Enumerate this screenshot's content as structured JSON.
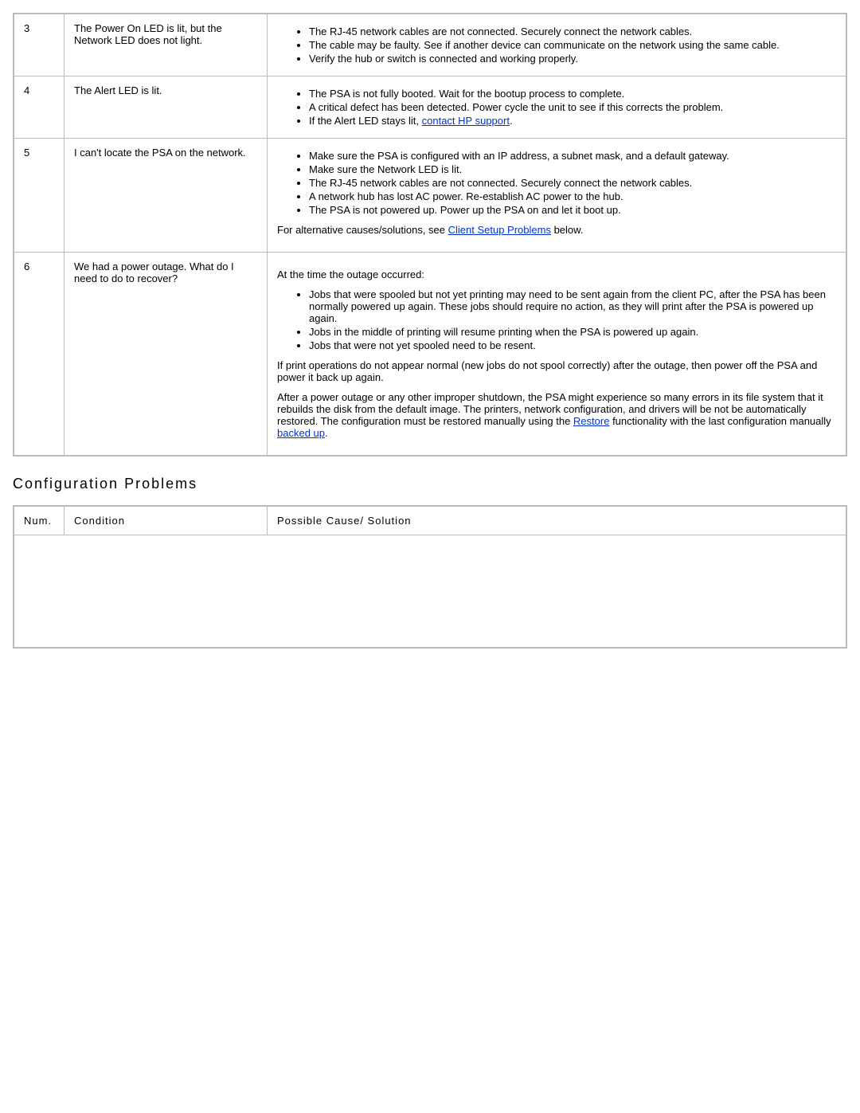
{
  "table1": {
    "rows": [
      {
        "num": "3",
        "condition": "The Power On LED is lit, but the Network LED does not light.",
        "bullets": [
          "The RJ-45 network cables are not connected. Securely connect the network cables.",
          "The cable may be faulty. See if another device can communicate on the network using the same cable.",
          "Verify the hub or switch is connected and working properly."
        ]
      },
      {
        "num": "4",
        "condition": "The Alert LED is lit.",
        "bullets": [
          "The PSA is not fully booted. Wait for the bootup process to complete.",
          "A critical defect has been detected. Power cycle the unit to see if this corrects the problem."
        ],
        "bullet_with_link_pre": "If the Alert LED stays lit, ",
        "bullet_with_link_text": "contact HP support",
        "bullet_with_link_post": "."
      },
      {
        "num": "5",
        "condition": "I can't locate the PSA on the network.",
        "bullets": [
          "Make sure the PSA is configured with an IP address, a subnet mask, and a default gateway.",
          "Make sure the Network LED is lit.",
          "The RJ-45 network cables are not connected. Securely connect the network cables.",
          "A network hub has lost AC power. Re-establish AC power to the hub.",
          "The PSA is not powered up. Power up the PSA on and let it boot up."
        ],
        "extra_pre": "For alternative causes/solutions, see ",
        "extra_link": "Client Setup Problems",
        "extra_post": " below."
      },
      {
        "num": "6",
        "condition": "We had a power outage. What do I need to do to recover?",
        "intro": "At the time the outage occurred:",
        "bullets": [
          "Jobs that were spooled but not yet printing may need to be sent again from the client PC, after the PSA has been normally powered up again. These jobs should require no action, as they will print after the PSA is powered up again.",
          "Jobs in the middle of printing will resume printing when the PSA is powered up again.",
          "Jobs that were not yet spooled need to be resent."
        ],
        "para1": "If print operations do not appear normal (new jobs do not spool correctly) after the outage, then power off the PSA and power it back up again.",
        "para2_pre": "After a power outage or any other improper shutdown, the PSA might experience so many errors in its file system that it rebuilds the disk from the default image. The printers, network configuration, and drivers will be not be automatically restored. The configuration must be restored manually using the ",
        "para2_link1": "Restore",
        "para2_mid": " functionality with the last configuration manually ",
        "para2_link2": "backed up",
        "para2_post": "."
      }
    ]
  },
  "heading": "Configuration Problems",
  "table2": {
    "headers": {
      "num": "Num.",
      "condition": "Condition",
      "solution": "Possible Cause/ Solution"
    }
  }
}
